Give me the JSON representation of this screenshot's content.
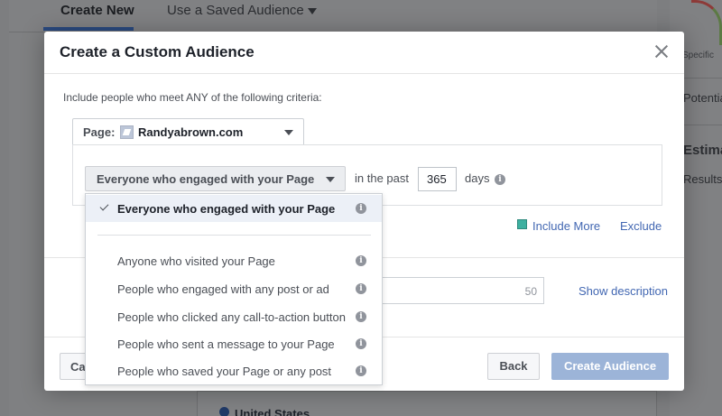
{
  "background": {
    "tabs": [
      "Create New",
      "Use a Saved Audience"
    ],
    "right_panel": [
      "Specific",
      "Potential",
      "Estima",
      "Results"
    ],
    "country": "United States"
  },
  "dialog": {
    "title": "Create a Custom Audience",
    "criteria_label": "Include people who meet ANY of the following criteria:",
    "page_label": "Page:",
    "page_name": "Randyabrown.com",
    "engagement_selected": "Everyone who engaged with your Page",
    "in_the_past": "in the past",
    "days_value": "365",
    "days_label": "days",
    "include_more": "Include More",
    "exclude": "Exclude",
    "description_count": "50",
    "show_description": "Show description",
    "cancel_label": "Ca",
    "back_label": "Back",
    "create_label": "Create Audience"
  },
  "dropdown": {
    "selected": "Everyone who engaged with your Page",
    "options": [
      "Anyone who visited your Page",
      "People who engaged with any post or ad",
      "People who clicked any call-to-action button",
      "People who sent a message to your Page",
      "People who saved your Page or any post"
    ]
  },
  "colors": {
    "link": "#4267b2",
    "primary_disabled": "#9cb4d8",
    "selected_row": "#ecf0f7"
  }
}
